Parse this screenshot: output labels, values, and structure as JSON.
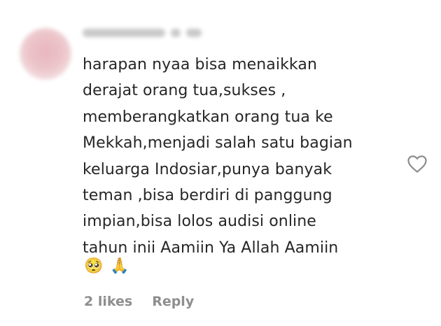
{
  "comment": {
    "text_lines": [
      "harapan nyaa bisa menaikkan",
      "derajat orang tua,sukses ,",
      "memberangkatkan orang tua ke",
      "Mekkah,menjadi salah satu bagian",
      "keluarga Indosiar,punya banyak",
      "teman ,bisa berdiri di panggung",
      "impian,bisa lolos audisi online",
      "tahun inii Aamiin Ya Allah Aamiin"
    ],
    "emojis": [
      "🥺",
      "🙏"
    ],
    "likes_label": "2 likes",
    "reply_label": "Reply"
  },
  "icons": {
    "like": "heart-outline-icon"
  },
  "colors": {
    "text": "#262626",
    "meta": "#8e8e8e",
    "icon": "#8e8e8e"
  }
}
